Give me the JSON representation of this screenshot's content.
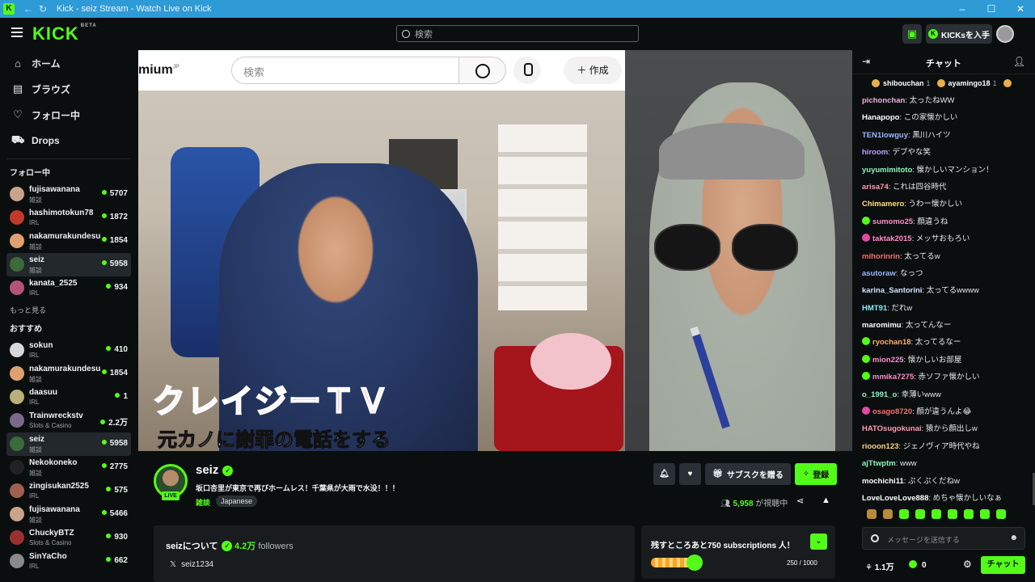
{
  "window": {
    "title": "Kick - seiz Stream - Watch Live on Kick"
  },
  "topbar": {
    "brand": "KICK",
    "brand_tag": "BETA",
    "search_placeholder": "検索",
    "get_kicks_label": "KICKsを入手"
  },
  "sidebar": {
    "nav": [
      {
        "label": "ホーム",
        "icon": "home-icon"
      },
      {
        "label": "ブラウズ",
        "icon": "browse-icon"
      },
      {
        "label": "フォロー中",
        "icon": "heart-icon"
      },
      {
        "label": "Drops",
        "icon": "drops-icon"
      }
    ],
    "following_title": "フォロー中",
    "following": [
      {
        "name": "fujisawanana",
        "category": "雑談",
        "viewers": "5707",
        "color": "#c9a38a"
      },
      {
        "name": "hashimotokun78",
        "category": "IRL",
        "viewers": "1872",
        "color": "#c0392b"
      },
      {
        "name": "nakamurakundesu",
        "category": "雑談",
        "viewers": "1854",
        "color": "#e0a070"
      },
      {
        "name": "seiz",
        "category": "雑談",
        "viewers": "5958",
        "color": "#3b6b3b"
      },
      {
        "name": "kanata_2525",
        "category": "IRL",
        "viewers": "934",
        "color": "#b5527a"
      }
    ],
    "show_more": "もっと見る",
    "recommended_title": "おすすめ",
    "recommended": [
      {
        "name": "sokun",
        "category": "IRL",
        "viewers": "410",
        "color": "#d8d8d8"
      },
      {
        "name": "nakamurakundesu",
        "category": "雑談",
        "viewers": "1854",
        "color": "#e0a070"
      },
      {
        "name": "daasuu",
        "category": "IRL",
        "viewers": "1",
        "color": "#b8b07a"
      },
      {
        "name": "Trainwreckstv",
        "category": "Slots & Casino",
        "viewers": "2.2万",
        "color": "#7a6a8a"
      },
      {
        "name": "seiz",
        "category": "雑談",
        "viewers": "5958",
        "color": "#3b6b3b"
      },
      {
        "name": "Nekokoneko",
        "category": "雑談",
        "viewers": "2775",
        "color": "#222222"
      },
      {
        "name": "zingisukan2525",
        "category": "IRL",
        "viewers": "575",
        "color": "#a06050"
      },
      {
        "name": "fujisawanana",
        "category": "雑談",
        "viewers": "5466",
        "color": "#c9a38a"
      },
      {
        "name": "ChuckyBTZ",
        "category": "Slots & Casino",
        "viewers": "930",
        "color": "#9a3030"
      },
      {
        "name": "SinYaCho",
        "category": "IRL",
        "viewers": "662",
        "color": "#8a8a8a"
      }
    ]
  },
  "video": {
    "yt_logo": "mium",
    "yt_region": "JP",
    "yt_search_placeholder": "検索",
    "yt_create": "作成",
    "caption_title": "クレイジーＴＶ",
    "caption_sub": "元カノに謝罪の電話をする"
  },
  "stream": {
    "name": "seiz",
    "live_badge": "LIVE",
    "title": "坂口杏里が東京で再びホームレス！千葉県が大雨で水没！！！",
    "category": "雑談",
    "language": "Japanese",
    "gift_sub_label": "サブスクを贈る",
    "follow_label": "登録",
    "viewer_count": "5,958",
    "viewer_suffix": "が視聴中",
    "about_title": "seizについて",
    "followers_count": "4.2万",
    "followers_label": "followers",
    "twitter_handle": "seiz1234",
    "goal_title": "残すところあと750 subscriptions 人！",
    "goal_progress": 0.25,
    "goal_count": "250 / 1000"
  },
  "chat": {
    "title": "チャット",
    "pinned": [
      {
        "name": "shibouchan",
        "rank": "1"
      },
      {
        "name": "ayamingo18",
        "rank": "1"
      }
    ],
    "messages": [
      {
        "user": "pichonchan",
        "text": ": 太ったねWW",
        "color": "#f0b0e0",
        "badge": ""
      },
      {
        "user": "Hanapopo",
        "text": ": この家懐かしい",
        "color": "#ffffff",
        "badge": ""
      },
      {
        "user": "TEN1lowguy",
        "text": ": 黒川ハイツ",
        "color": "#9ab8ff",
        "badge": ""
      },
      {
        "user": "hiroom",
        "text": ": デブやな笑",
        "color": "#b9a3ff",
        "badge": ""
      },
      {
        "user": "yuyumimitoto",
        "text": ": 懐かしいマンション！",
        "color": "#8ef5c2",
        "badge": ""
      },
      {
        "user": "arisa74",
        "text": ": これは四谷時代",
        "color": "#ff9bb0",
        "badge": ""
      },
      {
        "user": "Chimamero",
        "text": ": うわー懐かしい",
        "color": "#ffe07a",
        "badge": ""
      },
      {
        "user": "sumomo25",
        "text": ": 顔違うね",
        "color": "#ff8fc8",
        "badge": "#53fc18"
      },
      {
        "user": "taktak2015",
        "text": ": メッサおもろい",
        "color": "#ff8fc8",
        "badge": "#e04aa0"
      },
      {
        "user": "mihorinrin",
        "text": ": 太ってるw",
        "color": "#ff6b6b",
        "badge": ""
      },
      {
        "user": "asutoraw",
        "text": ": なっつ",
        "color": "#9ab8ff",
        "badge": ""
      },
      {
        "user": "karina_Santorini",
        "text": ": 太ってるwwww",
        "color": "#cfe6ff",
        "badge": ""
      },
      {
        "user": "HMT91",
        "text": ": だれw",
        "color": "#7ff0ff",
        "badge": ""
      },
      {
        "user": "maromimu",
        "text": ": 太ってんなー",
        "color": "#ffffff",
        "badge": ""
      },
      {
        "user": "ryochan18",
        "text": ": 太ってるなー",
        "color": "#ffb070",
        "badge": "#53fc18"
      },
      {
        "user": "mion225",
        "text": ": 懐かしいお部屋",
        "color": "#ff8fc8",
        "badge": "#53fc18"
      },
      {
        "user": "mmika7275",
        "text": ": 赤ソファ懐かしい",
        "color": "#ff8fc8",
        "badge": "#53fc18"
      },
      {
        "user": "o_1991_o",
        "text": ": 幸薄いwww",
        "color": "#8ef5c2",
        "badge": ""
      },
      {
        "user": "osago8720",
        "text": ": 顔が違うんよ😂",
        "color": "#ff6b6b",
        "badge": "#e04aa0"
      },
      {
        "user": "HATOsugokunai",
        "text": ": 猿から顔出しw",
        "color": "#ff9bb0",
        "badge": ""
      },
      {
        "user": "riooon123",
        "text": ": ジェノヴィア時代やね",
        "color": "#ffd27a",
        "badge": ""
      },
      {
        "user": "ajTtwptm",
        "text": ": www",
        "color": "#8ef5c2",
        "badge": ""
      },
      {
        "user": "mochichi11",
        "text": ": ぷくぷくだねw",
        "color": "#ffffff",
        "badge": ""
      },
      {
        "user": "LoveLoveLove888",
        "text": ": めちゃ懐かしいなぁ",
        "color": "#ffffff",
        "badge": ""
      }
    ],
    "input_placeholder": "メッセージを送信する",
    "points": "1.1万",
    "kicks": "0",
    "send_label": "チャット"
  }
}
